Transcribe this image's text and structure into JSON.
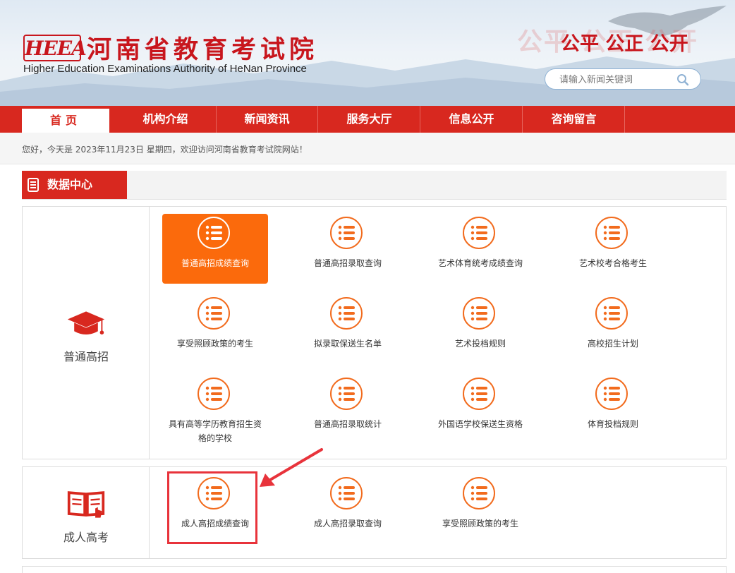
{
  "header": {
    "logo_mark": "HEEA",
    "title": "河南省教育考试院",
    "subtitle": "Higher Education Examinations Authority of HeNan Province",
    "slogan_ghost": "公平 公正 公开",
    "slogan": "公平 公正 公开",
    "search_placeholder": "请输入新闻关键词"
  },
  "nav": {
    "items": [
      {
        "label": "首页"
      },
      {
        "label": "机构介绍"
      },
      {
        "label": "新闻资讯"
      },
      {
        "label": "服务大厅"
      },
      {
        "label": "信息公开"
      },
      {
        "label": "咨询留言"
      }
    ]
  },
  "greeting": "您好，今天是 2023年11月23日 星期四，欢迎访问河南省教育考试院网站！",
  "section": {
    "title": "数据中心"
  },
  "panels": [
    {
      "label": "普通高招",
      "icon": "graduation-cap-icon",
      "tiles": [
        {
          "label": "普通高招成绩查询"
        },
        {
          "label": "普通高招录取查询"
        },
        {
          "label": "艺术体育统考成绩查询"
        },
        {
          "label": "艺术校考合格考生"
        },
        {
          "label": "享受照顾政策的考生"
        },
        {
          "label": "拟录取保送生名单"
        },
        {
          "label": "艺术投档规则"
        },
        {
          "label": "高校招生计划"
        },
        {
          "label": "具有高等学历教育招生资格的学校"
        },
        {
          "label": "普通高招录取统计"
        },
        {
          "label": "外国语学校保送生资格"
        },
        {
          "label": "体育投档规则"
        }
      ]
    },
    {
      "label": "成人高考",
      "icon": "open-book-icon",
      "tiles": [
        {
          "label": "成人高招成绩查询"
        },
        {
          "label": "成人高招录取查询"
        },
        {
          "label": "享受照顾政策的考生"
        }
      ]
    }
  ],
  "colors": {
    "brand_red": "#d8281f",
    "accent_orange": "#fb6a0c",
    "highlight_red": "#e8333b"
  }
}
